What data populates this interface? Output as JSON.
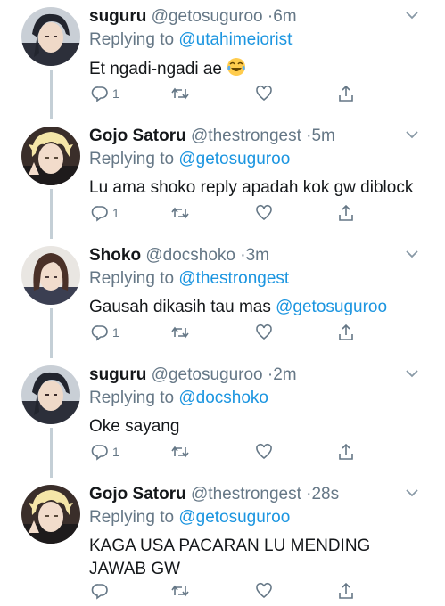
{
  "tweets": [
    {
      "name": "suguru",
      "handle": "@getosuguroo",
      "time": "6m",
      "reply_prefix": "Replying to",
      "reply_to": "@utahimeiorist",
      "text": "Et ngadi-ngadi ae",
      "emoji": "face-with-tears-of-joy",
      "reply_count": "1"
    },
    {
      "name": "Gojo Satoru",
      "handle": "@thestrongest",
      "time": "5m",
      "reply_prefix": "Replying to",
      "reply_to": "@getosuguroo",
      "text": "Lu ama shoko reply apadah kok gw diblock",
      "reply_count": "1"
    },
    {
      "name": "Shoko",
      "handle": "@docshoko",
      "time": "3m",
      "reply_prefix": "Replying to",
      "reply_to": "@thestrongest",
      "text": "Gausah dikasih tau mas",
      "text_mention": "@getosuguroo",
      "reply_count": "1"
    },
    {
      "name": "suguru",
      "handle": "@getosuguroo",
      "time": "2m",
      "reply_prefix": "Replying to",
      "reply_to": "@docshoko",
      "text": "Oke sayang",
      "reply_count": "1"
    },
    {
      "name": "Gojo Satoru",
      "handle": "@thestrongest",
      "time": "28s",
      "reply_prefix": "Replying to",
      "reply_to": "@getosuguroo",
      "text_line1": "KAGA USA PACARAN LU MENDING",
      "text_line2": "JAWAB GW",
      "reply_count": ""
    }
  ],
  "dot": "·",
  "colors": {
    "link": "#1b95e0",
    "secondary": "#657786",
    "thread_line": "#c4cfd6"
  }
}
